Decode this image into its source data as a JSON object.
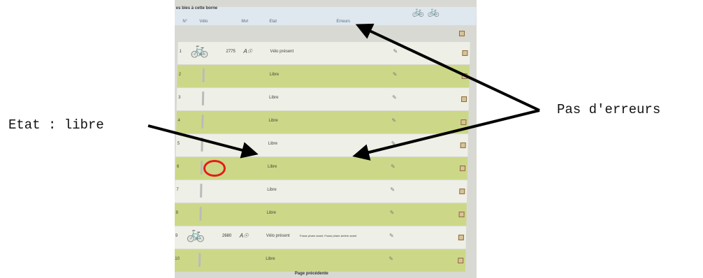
{
  "caption": "es bies à cette borne",
  "headers": {
    "num": "N°",
    "velo": "Vélo",
    "mvt": "Mvt",
    "etat": "Etat",
    "erreurs": "Erreurs"
  },
  "rows": [
    {
      "num": "1",
      "bike": true,
      "bike_no": "2775",
      "mvt": "A☉",
      "etat": "Vélo présent",
      "errors": "",
      "color": "w"
    },
    {
      "num": "2",
      "bike": false,
      "bike_no": "",
      "mvt": "",
      "etat": "Libre",
      "errors": "",
      "color": "g"
    },
    {
      "num": "3",
      "bike": false,
      "bike_no": "",
      "mvt": "",
      "etat": "Libre",
      "errors": "",
      "color": "w"
    },
    {
      "num": "4",
      "bike": false,
      "bike_no": "",
      "mvt": "",
      "etat": "Libre",
      "errors": "",
      "color": "g"
    },
    {
      "num": "5",
      "bike": false,
      "bike_no": "",
      "mvt": "",
      "etat": "Libre",
      "errors": "",
      "color": "w"
    },
    {
      "num": "6",
      "bike": false,
      "bike_no": "",
      "mvt": "",
      "etat": "Libre",
      "errors": "",
      "color": "g"
    },
    {
      "num": "7",
      "bike": false,
      "bike_no": "",
      "mvt": "",
      "etat": "Libre",
      "errors": "",
      "color": "w"
    },
    {
      "num": "8",
      "bike": false,
      "bike_no": "",
      "mvt": "",
      "etat": "Libre",
      "errors": "",
      "color": "g"
    },
    {
      "num": "9",
      "bike": true,
      "bike_no": "2680",
      "mvt": "A☉",
      "etat": "Vélo présent",
      "errors": "Fosse phare avant, Fosse phare arrière avant",
      "color": "w"
    },
    {
      "num": "10",
      "bike": false,
      "bike_no": "",
      "mvt": "",
      "etat": "Libre",
      "errors": "",
      "color": "g"
    }
  ],
  "footer": "Page précédente",
  "annotations": {
    "etat_libre": "Etat : libre",
    "pas_erreurs": "Pas d'erreurs"
  },
  "colors": {
    "green_row": "#ccd887",
    "white_row": "#eeefe6",
    "highlight": "#e51b1b"
  }
}
